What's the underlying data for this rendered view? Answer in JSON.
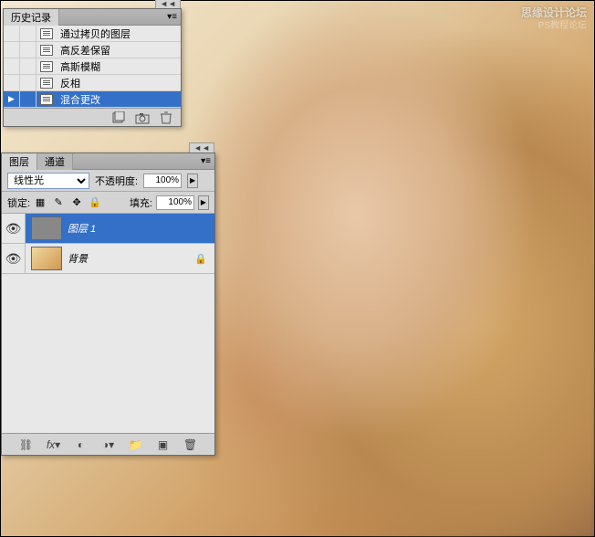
{
  "watermark": {
    "line1": "思缘设计论坛",
    "line2": "PS教程论坛"
  },
  "history": {
    "title": "历史记录",
    "items": [
      {
        "label": "通过拷贝的图层"
      },
      {
        "label": "高反差保留"
      },
      {
        "label": "高斯模糊"
      },
      {
        "label": "反相"
      },
      {
        "label": "混合更改"
      }
    ]
  },
  "layers": {
    "tab1": "图层",
    "tab2": "通道",
    "blend_mode": "线性光",
    "opacity_label": "不透明度:",
    "opacity_value": "100%",
    "lock_label": "锁定:",
    "fill_label": "填充:",
    "fill_value": "100%",
    "items": [
      {
        "name": "图层 1",
        "locked": false
      },
      {
        "name": "背景",
        "locked": true
      }
    ]
  }
}
